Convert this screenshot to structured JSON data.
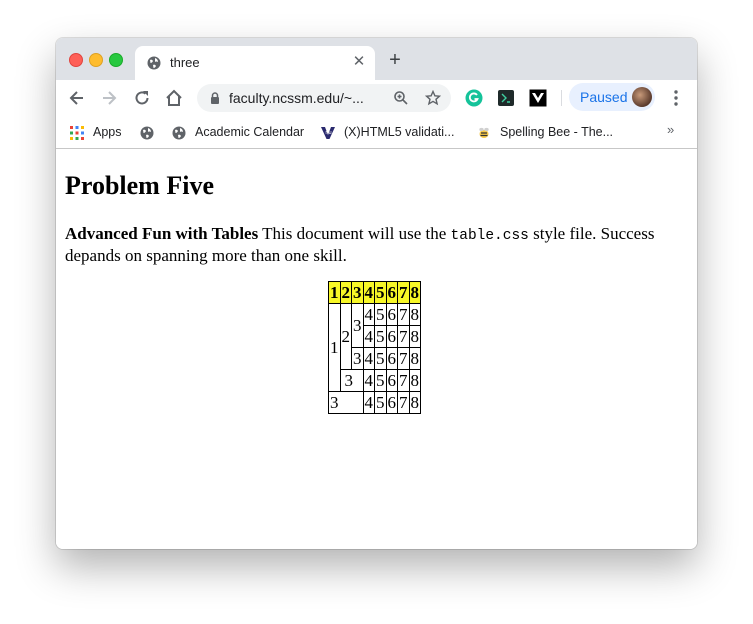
{
  "browser": {
    "tab": {
      "title": "three"
    },
    "address": {
      "url": "faculty.ncssm.edu/~..."
    },
    "profile": {
      "label": "Paused"
    },
    "bookmarks": [
      {
        "label": "Apps"
      },
      {
        "label": ""
      },
      {
        "label": "Academic Calendar"
      },
      {
        "label": "(X)HTML5 validati..."
      },
      {
        "label": "Spelling Bee - The..."
      }
    ]
  },
  "page": {
    "heading": "Problem Five",
    "intro_bold": "Advanced Fun with Tables",
    "intro_1": " This document will use the ",
    "intro_code": "table.css",
    "intro_2": " style file. Success depands on spanning more than one skill."
  },
  "table": {
    "header": [
      "1",
      "2",
      "3",
      "4",
      "5",
      "6",
      "7",
      "8"
    ],
    "cells": {
      "c1": "1",
      "c2": "2",
      "c3a": "3",
      "c3b": "3",
      "c3c": "3",
      "c3d": "3",
      "n4": "4",
      "n5": "5",
      "n6": "6",
      "n7": "7",
      "n8": "8"
    }
  },
  "colors": {
    "header_fill": "#f7f727",
    "profile_text": "#1a73e8",
    "tabbar": "#dee1e6"
  }
}
